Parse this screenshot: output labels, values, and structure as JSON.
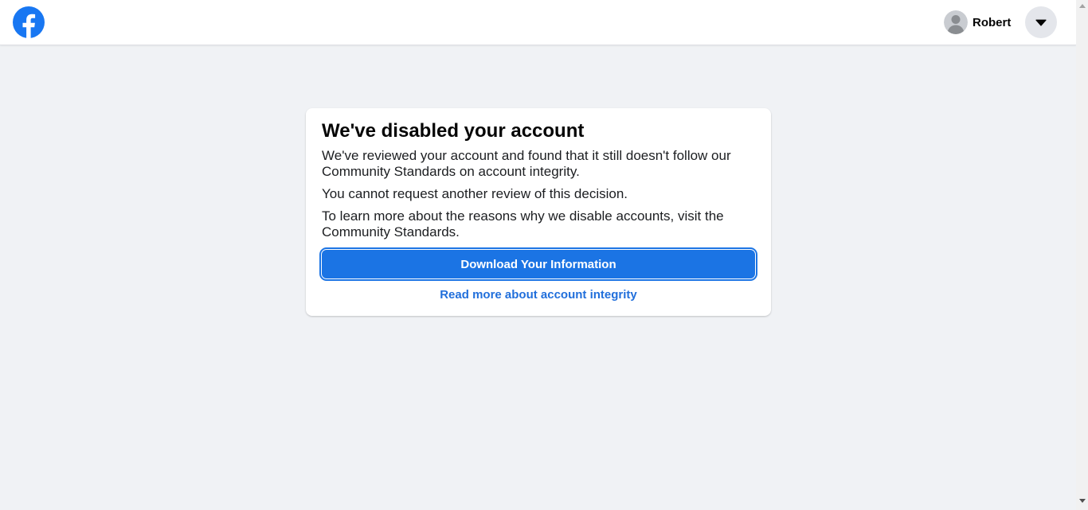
{
  "header": {
    "profile_name": "Robert"
  },
  "card": {
    "title": "We've disabled your account",
    "paragraph1": "We've reviewed your account and found that it still doesn't follow our Community Standards on account integrity.",
    "paragraph2": "You cannot request another review of this decision.",
    "paragraph3": "To learn more about the reasons why we disable accounts, visit the Community Standards.",
    "download_button": "Download Your Information",
    "read_more_link": "Read more about account integrity"
  },
  "colors": {
    "brand": "#1877f2",
    "button": "#1b74e4",
    "link": "#216fdb",
    "background": "#f0f2f5"
  },
  "icons": {
    "logo": "facebook-logo-icon",
    "avatar": "default-avatar-icon",
    "menu": "caret-down-icon"
  }
}
